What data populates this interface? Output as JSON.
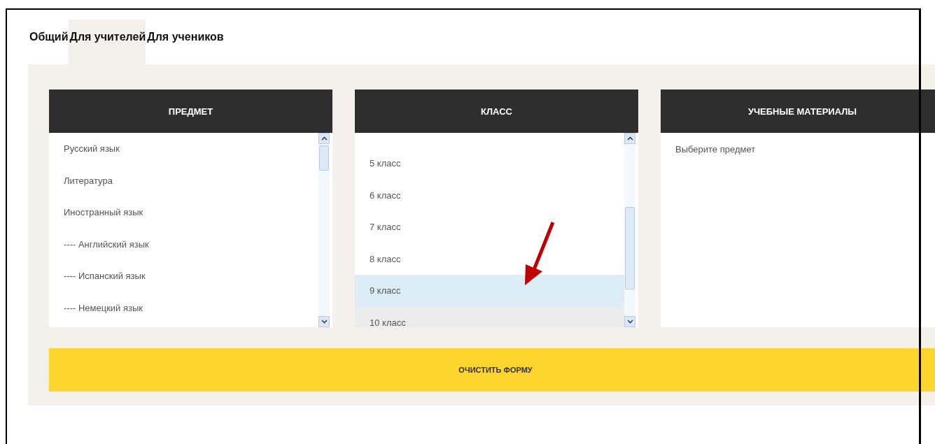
{
  "tabs": [
    {
      "label": "Общий",
      "selected": false
    },
    {
      "label": "Для учителей",
      "selected": true
    },
    {
      "label": "Для учеников",
      "selected": false
    }
  ],
  "columns": [
    {
      "kind": "subjects",
      "header": "ПРЕДМЕТ",
      "items": [
        {
          "label": "Русский язык",
          "selected": false
        },
        {
          "label": "Литература",
          "selected": false
        },
        {
          "label": "Иностранный язык",
          "selected": false,
          "children": [
            {
              "label": "---- Английский язык",
              "selected": false
            },
            {
              "label": "---- Испанский язык",
              "selected": false
            },
            {
              "label": "---- Немецкий язык",
              "selected": false
            }
          ]
        }
      ]
    },
    {
      "kind": "classes",
      "header": "КЛАСС",
      "items": [
        {
          "label": "5 класс",
          "selected": false,
          "hovered": false
        },
        {
          "label": "6 класс",
          "selected": false,
          "hovered": false
        },
        {
          "label": "7 класс",
          "selected": false,
          "hovered": false
        },
        {
          "label": "8 класс",
          "selected": false,
          "hovered": false
        },
        {
          "label": "9 класс",
          "selected": true,
          "hovered": false
        },
        {
          "label": "10 класс",
          "selected": false,
          "hovered": true
        }
      ]
    },
    {
      "kind": "materials",
      "header": "УЧЕБНЫЕ МАТЕРИАЛЫ",
      "message": "Выберите предмет"
    }
  ],
  "clear_button": "ОЧИСТИТЬ ФОРМУ"
}
